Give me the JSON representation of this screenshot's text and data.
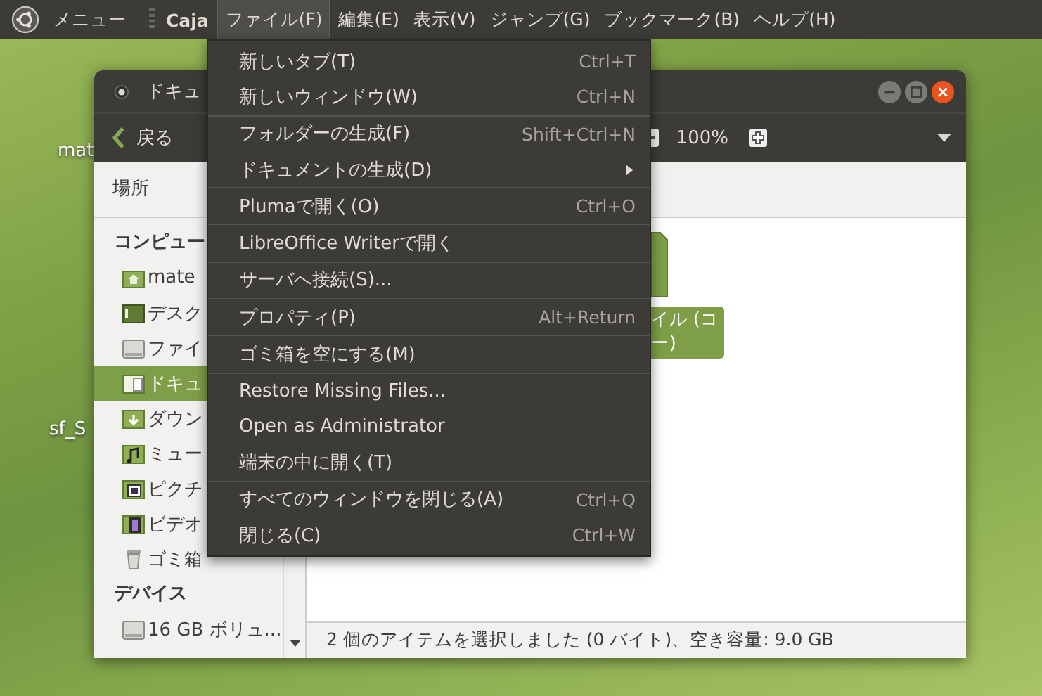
{
  "top_bar": {
    "menu_label": "メニュー",
    "app_name": "Caja",
    "menus": [
      {
        "label": "ファイル(F)",
        "selected": true
      },
      {
        "label": "編集(E)",
        "selected": false
      },
      {
        "label": "表示(V)",
        "selected": false
      },
      {
        "label": "ジャンプ(G)",
        "selected": false
      },
      {
        "label": "ブックマーク(B)",
        "selected": false
      },
      {
        "label": "ヘルプ(H)",
        "selected": false
      }
    ]
  },
  "desktop_icons": [
    {
      "label": "mat"
    },
    {
      "label": "sf_S"
    }
  ],
  "window": {
    "title": "ドキュ",
    "back_label": "戻る",
    "zoom_label": "100%",
    "location_label": "場所",
    "sidebar": [
      {
        "heading": "コンピュー",
        "items": [
          {
            "label": "mate",
            "kind": "home",
            "selected": false
          },
          {
            "label": "デスク",
            "kind": "desktop",
            "selected": false
          },
          {
            "label": "ファイ",
            "kind": "drive",
            "selected": false
          },
          {
            "label": "ドキュ",
            "kind": "documents",
            "selected": true
          },
          {
            "label": "ダウン",
            "kind": "downloads",
            "selected": false
          },
          {
            "label": "ミュー",
            "kind": "music",
            "selected": false
          },
          {
            "label": "ピクチ",
            "kind": "pictures",
            "selected": false
          },
          {
            "label": "ビデオ",
            "kind": "videos",
            "selected": false
          },
          {
            "label": "ゴミ箱",
            "kind": "trash",
            "selected": false
          }
        ]
      },
      {
        "heading": "デバイス",
        "items": [
          {
            "label": "16 GB ボリュ...",
            "kind": "drive",
            "selected": false
          }
        ]
      }
    ],
    "files": [
      {
        "label_lines": [
          "イル (コ",
          "ー)"
        ],
        "selected": true
      }
    ],
    "status_bar": "2 個のアイテムを選択しました (0 バイト)、空き容量: 9.0 GB"
  },
  "file_menu": {
    "groups": [
      [
        {
          "label": "新しいタブ(T)",
          "shortcut": "Ctrl+T",
          "has_submenu": false
        },
        {
          "label": "新しいウィンドウ(W)",
          "shortcut": "Ctrl+N",
          "has_submenu": false
        }
      ],
      [
        {
          "label": "フォルダーの生成(F)",
          "shortcut": "Shift+Ctrl+N",
          "has_submenu": false
        },
        {
          "label": "ドキュメントの生成(D)",
          "has_submenu": true
        }
      ],
      [
        {
          "label": "Plumaで開く(O)",
          "shortcut": "Ctrl+O",
          "has_submenu": false
        }
      ],
      [
        {
          "label": "LibreOffice Writerで開く",
          "has_submenu": false
        }
      ],
      [
        {
          "label": "サーバへ接続(S)...",
          "has_submenu": false
        }
      ],
      [
        {
          "label": "プロパティ(P)",
          "shortcut": "Alt+Return",
          "has_submenu": false
        }
      ],
      [
        {
          "label": "ゴミ箱を空にする(M)",
          "has_submenu": false
        }
      ],
      [
        {
          "label": "Restore Missing Files...",
          "has_submenu": false
        },
        {
          "label": "Open as Administrator",
          "has_submenu": false
        },
        {
          "label": "端末の中に開く(T)",
          "has_submenu": false
        }
      ],
      [
        {
          "label": "すべてのウィンドウを閉じる(A)",
          "shortcut": "Ctrl+Q",
          "has_submenu": false
        },
        {
          "label": "閉じる(C)",
          "shortcut": "Ctrl+W",
          "has_submenu": false
        }
      ]
    ]
  }
}
